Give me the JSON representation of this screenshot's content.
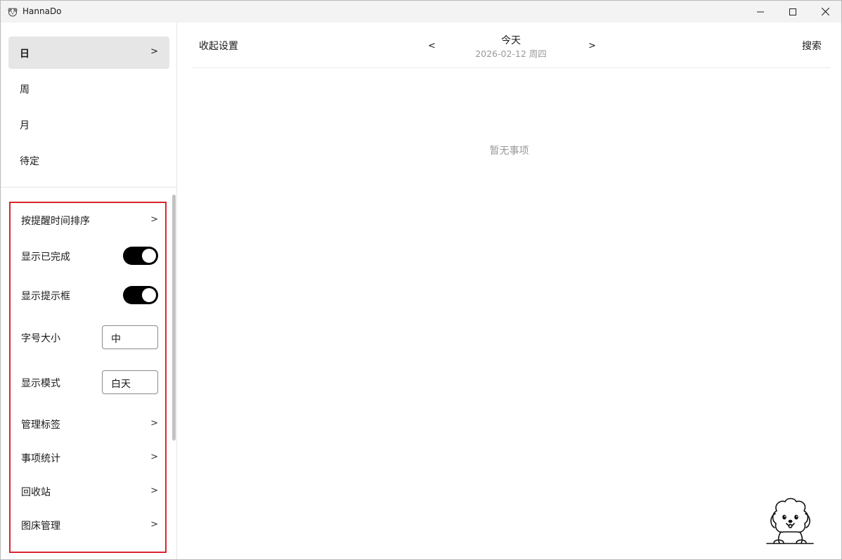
{
  "window": {
    "title": "HannaDo",
    "controls": [
      "minimize-icon",
      "maximize-icon",
      "close-icon"
    ]
  },
  "sidebar": {
    "views": [
      {
        "label": "日",
        "chevron": ">",
        "active": true
      },
      {
        "label": "周"
      },
      {
        "label": "月"
      },
      {
        "label": "待定"
      }
    ],
    "settings": {
      "sort": {
        "label": "按提醒时间排序",
        "chevron": ">"
      },
      "show_completed": {
        "label": "显示已完成",
        "on": true
      },
      "show_tips": {
        "label": "显示提示框",
        "on": true
      },
      "font_size": {
        "label": "字号大小",
        "value": "中"
      },
      "display_mode": {
        "label": "显示模式",
        "value": "白天"
      },
      "manage_tags": {
        "label": "管理标签",
        "chevron": ">"
      },
      "stats": {
        "label": "事项统计",
        "chevron": ">"
      },
      "recycle": {
        "label": "回收站",
        "chevron": ">"
      },
      "image_host": {
        "label": "图床管理",
        "chevron": ">"
      }
    }
  },
  "header": {
    "collapse_label": "收起设置",
    "prev": "<",
    "next": ">",
    "date_title": "今天",
    "date_sub": "2026-02-12 周四",
    "search_label": "搜索"
  },
  "main": {
    "empty_text": "暂无事项",
    "mascot": "dog-mascot-icon"
  },
  "colors": {
    "accent_border": "#d9252f",
    "toggle_on": "#000000",
    "active_nav_bg": "#e6e6e6",
    "muted_text": "#999999"
  }
}
